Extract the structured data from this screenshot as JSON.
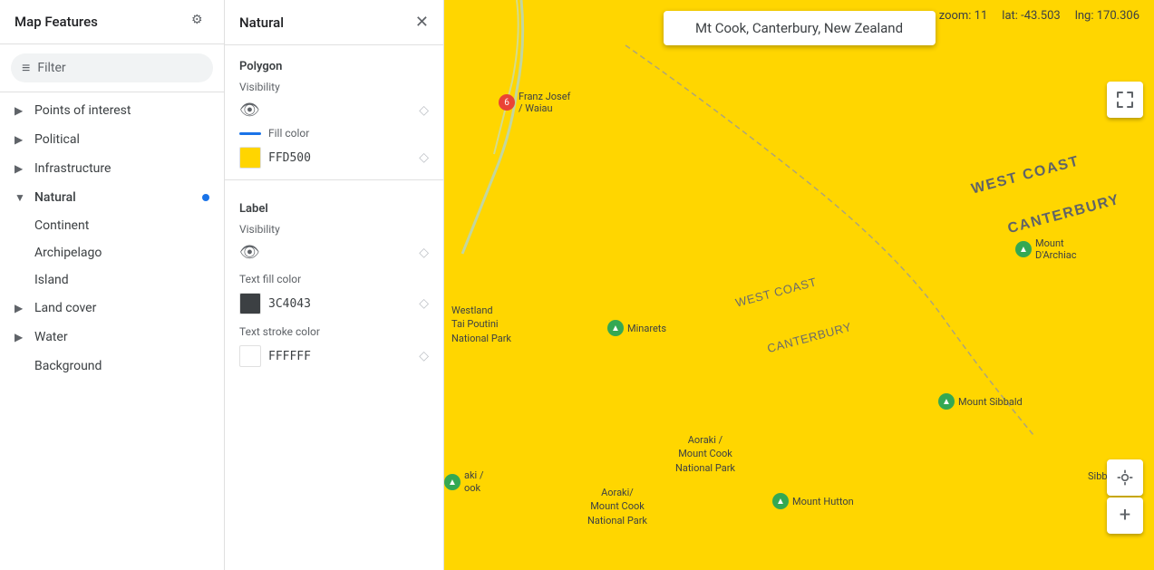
{
  "leftPanel": {
    "title": "Map Features",
    "filter": {
      "placeholder": "Filter",
      "icon": "≡"
    },
    "navItems": [
      {
        "id": "points-of-interest",
        "label": "Points of interest",
        "hasChevron": true,
        "expanded": false
      },
      {
        "id": "political",
        "label": "Political",
        "hasChevron": true,
        "expanded": false
      },
      {
        "id": "infrastructure",
        "label": "Infrastructure",
        "hasChevron": true,
        "expanded": false
      },
      {
        "id": "natural",
        "label": "Natural",
        "hasChevron": true,
        "expanded": true,
        "hasDot": true
      }
    ],
    "naturalSubItems": [
      {
        "id": "continent",
        "label": "Continent"
      },
      {
        "id": "archipelago",
        "label": "Archipelago"
      },
      {
        "id": "island",
        "label": "Island"
      }
    ],
    "landCoverItem": {
      "label": "Land cover",
      "hasChevron": true
    },
    "waterItem": {
      "label": "Water",
      "hasChevron": true
    },
    "backgroundItem": {
      "label": "Background"
    }
  },
  "middlePanel": {
    "title": "Natural",
    "sections": {
      "polygon": {
        "sectionLabel": "Polygon",
        "visibility": {
          "label": "Visibility"
        },
        "fillColor": {
          "label": "Fill color",
          "swatch": "#FFD500",
          "code": "FFD500"
        }
      },
      "label": {
        "sectionLabel": "Label",
        "visibility": {
          "label": "Visibility"
        },
        "textFillColor": {
          "label": "Text fill color",
          "swatch": "#3C4043",
          "code": "3C4043"
        },
        "textStrokeColor": {
          "label": "Text stroke color",
          "swatch": "#FFFFFF",
          "code": "FFFFFF"
        }
      }
    }
  },
  "map": {
    "zoom": "11",
    "lat": "-43.503",
    "lng": "170.306",
    "searchBox": "Mt Cook, Canterbury, New Zealand",
    "labels": [
      {
        "text": "WEST COAST",
        "style": "large",
        "top": "190",
        "left": "640"
      },
      {
        "text": "CANTERBURY",
        "style": "large",
        "top": "233",
        "left": "680"
      },
      {
        "text": "WEST COAST",
        "style": "medium",
        "top": "319",
        "left": "790"
      },
      {
        "text": "CANTERBURY",
        "style": "medium",
        "top": "368",
        "left": "800"
      }
    ],
    "pois": [
      {
        "id": "franz-josef",
        "label": "Franz Josef\n/ Waiau",
        "top": "110",
        "left": "75",
        "iconColor": "red",
        "number": "6"
      },
      {
        "id": "mount-darchiac",
        "label": "Mount\nD'Archiac",
        "top": "263",
        "left": "620",
        "iconColor": "green"
      },
      {
        "id": "minarets",
        "label": "Minarets",
        "top": "353",
        "left": "215",
        "iconColor": "green"
      },
      {
        "id": "westland",
        "label": "Westland\nTai Poutini\nNational Park",
        "top": "345",
        "left": "28",
        "iconColor": null
      },
      {
        "id": "mount-sibbald",
        "label": "Mount Sibbald",
        "top": "435",
        "left": "565",
        "iconColor": "green"
      },
      {
        "id": "sibbald",
        "label": "Sibbald",
        "top": "520",
        "left": "720",
        "iconColor": null
      },
      {
        "id": "aoraki-1",
        "label": "Aoraki /\nMount Cook\nNational Park",
        "top": "480",
        "left": "265",
        "iconColor": null
      },
      {
        "id": "aoraki-2",
        "label": "Aoraki/\nMount Cook\nNational Park",
        "top": "537",
        "left": "165",
        "iconColor": null
      },
      {
        "id": "mount-hutton",
        "label": "Mount Hutton",
        "top": "545",
        "left": "370",
        "iconColor": "green"
      },
      {
        "id": "aoraki-cook-left",
        "label": "aki /\nook",
        "top": "520",
        "left": "0",
        "iconColor": "green"
      }
    ]
  },
  "icons": {
    "gear": "⚙",
    "close": "✕",
    "eye": "👁",
    "diamond": "◇",
    "fullscreen": "⛶",
    "location": "◎",
    "plus": "+",
    "filterIcon": "≡"
  }
}
